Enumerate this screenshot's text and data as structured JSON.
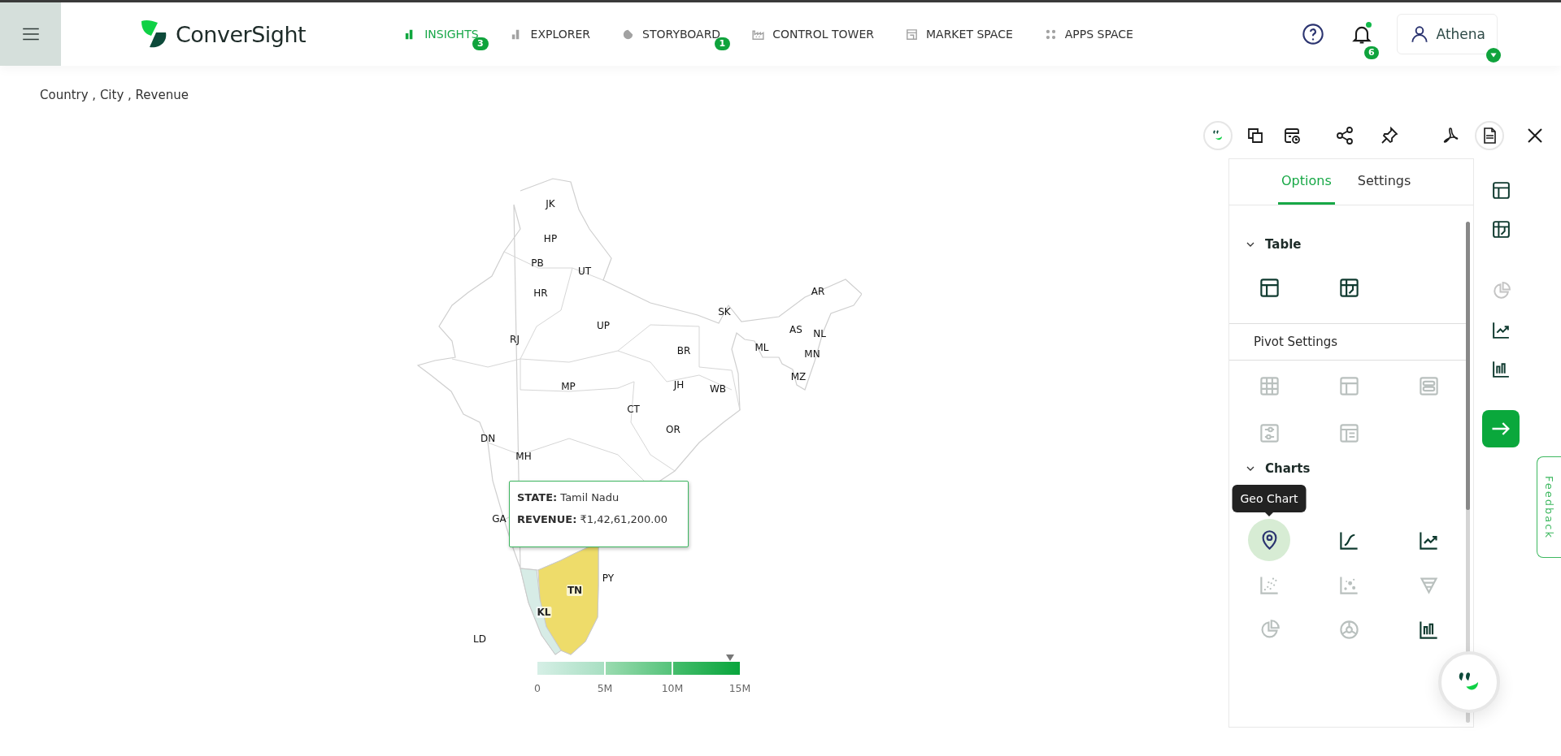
{
  "header": {
    "brand": "ConverSight",
    "nav": [
      {
        "label": "INSIGHTS",
        "selected": true,
        "badge": "3"
      },
      {
        "label": "EXPLORER",
        "selected": false
      },
      {
        "label": "STORYBOARD",
        "selected": false,
        "badge": "1"
      },
      {
        "label": "CONTROL TOWER",
        "selected": false
      },
      {
        "label": "MARKET SPACE",
        "selected": false
      },
      {
        "label": "APPS SPACE",
        "selected": false
      }
    ],
    "notifications": {
      "badge": "6",
      "unread": true
    },
    "user": {
      "name": "Athena"
    }
  },
  "breadcrumb": "Country , City , Revenue",
  "map": {
    "regions": [
      {
        "label": "JK"
      },
      {
        "label": "HP"
      },
      {
        "label": "PB"
      },
      {
        "label": "UT"
      },
      {
        "label": "HR"
      },
      {
        "label": "AR"
      },
      {
        "label": "SK"
      },
      {
        "label": "UP"
      },
      {
        "label": "RJ"
      },
      {
        "label": "AS"
      },
      {
        "label": "NL"
      },
      {
        "label": "BR"
      },
      {
        "label": "ML"
      },
      {
        "label": "MN"
      },
      {
        "label": "MZ"
      },
      {
        "label": "MP"
      },
      {
        "label": "JH"
      },
      {
        "label": "WB"
      },
      {
        "label": "CT"
      },
      {
        "label": "OR"
      },
      {
        "label": "DN"
      },
      {
        "label": "MH"
      },
      {
        "label": "GA"
      },
      {
        "label": "PY"
      },
      {
        "label": "TN",
        "color": "#eedc6a"
      },
      {
        "label": "KL",
        "color": "#d7ece6"
      },
      {
        "label": "LD"
      }
    ],
    "tooltip": {
      "rows": [
        {
          "key": "STATE:",
          "value": "Tamil Nadu"
        },
        {
          "key": "REVENUE:",
          "value": "₹1,42,61,200.00"
        }
      ]
    },
    "legend": {
      "ticks": [
        "0",
        "5M",
        "10M",
        "15M"
      ],
      "marker": {
        "level": 0.95
      }
    }
  },
  "panel": {
    "tabs": [
      {
        "label": "Options",
        "selected": true
      },
      {
        "label": "Settings",
        "selected": false
      }
    ],
    "sections": [
      {
        "title": "Table",
        "kind": "collapsible",
        "expanded": true,
        "items": [
          {
            "kind": "table",
            "disabled": false,
            "selected": false
          },
          {
            "kind": "pivot",
            "disabled": false,
            "selected": false
          }
        ]
      },
      {
        "title": "Pivot Settings",
        "kind": "plain",
        "items": [
          {
            "kind": "grid",
            "disabled": true,
            "selected": false
          },
          {
            "kind": "table",
            "disabled": true,
            "selected": false
          },
          {
            "kind": "rows",
            "disabled": true,
            "selected": false
          },
          {
            "kind": "filter",
            "disabled": true,
            "selected": false
          },
          {
            "kind": "list",
            "disabled": true,
            "selected": false
          }
        ]
      },
      {
        "title": "Charts",
        "kind": "collapsible",
        "expanded": true,
        "items": [
          {
            "kind": "geo",
            "disabled": false,
            "selected": true,
            "tooltip": "Geo Chart"
          },
          {
            "kind": "line",
            "disabled": false,
            "selected": false
          },
          {
            "kind": "area",
            "disabled": false,
            "selected": false
          },
          {
            "kind": "scatter",
            "disabled": true,
            "selected": false
          },
          {
            "kind": "bubble",
            "disabled": true,
            "selected": false
          },
          {
            "kind": "funnel",
            "disabled": true,
            "selected": false
          },
          {
            "kind": "pie",
            "disabled": true,
            "selected": false
          },
          {
            "kind": "donut",
            "disabled": true,
            "selected": false
          },
          {
            "kind": "bar",
            "disabled": false,
            "selected": false
          }
        ]
      }
    ]
  },
  "rail": {
    "groups": [
      [
        {
          "kind": "table",
          "disabled": false
        },
        {
          "kind": "pivot",
          "disabled": false
        }
      ],
      [
        {
          "kind": "pie",
          "disabled": true
        },
        {
          "kind": "area",
          "disabled": false
        },
        {
          "kind": "bar",
          "disabled": false
        }
      ]
    ]
  },
  "feedback": "Feedback"
}
